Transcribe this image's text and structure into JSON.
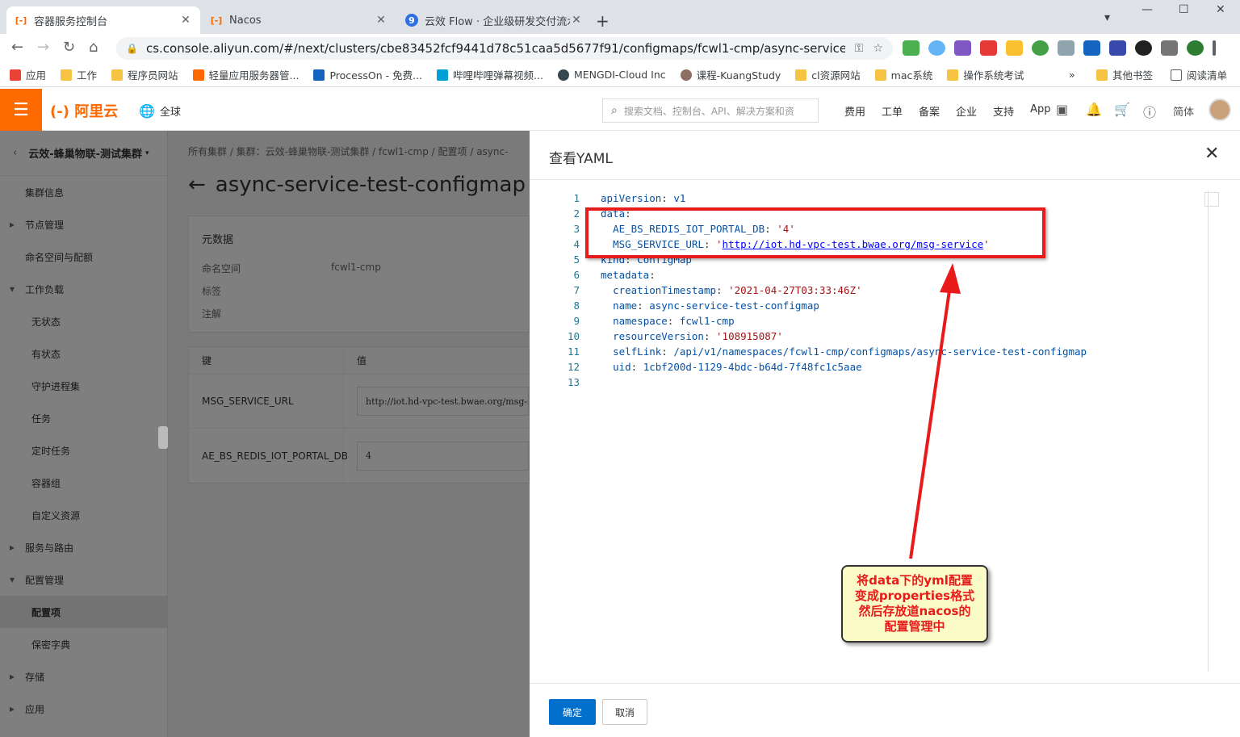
{
  "browser": {
    "tabs": [
      {
        "title": "容器服务控制台",
        "active": true
      },
      {
        "title": "Nacos",
        "active": false
      },
      {
        "title": "云效 Flow · 企业级研发交付流水线",
        "active": false
      }
    ],
    "url": "cs.console.aliyun.com/#/next/clusters/cbe83452fcf9441d78c51caa5d5677f91/configmaps/fcwl1-cmp/async-service-test-config...",
    "bookmarks": [
      "应用",
      "工作",
      "程序员网站",
      "轻量应用服务器管...",
      "ProcessOn - 免费...",
      "哔哩哔哩弹幕视频...",
      "MENGDI-Cloud Inc",
      "课程-KuangStudy",
      "cl资源网站",
      "mac系统",
      "操作系统考试"
    ],
    "bookmarks_right": [
      "其他书签",
      "阅读清单"
    ]
  },
  "header": {
    "logo": "阿里云",
    "region": "全球",
    "search_placeholder": "搜索文档、控制台、API、解决方案和资",
    "nav": [
      "费用",
      "工单",
      "备案",
      "企业",
      "支持",
      "App"
    ],
    "lang": "简体"
  },
  "sidebar": {
    "cluster": "云效-蜂巢物联-测试集群",
    "items": [
      {
        "label": "集群信息",
        "kind": "item"
      },
      {
        "label": "节点管理",
        "kind": "group"
      },
      {
        "label": "命名空间与配额",
        "kind": "item"
      },
      {
        "label": "工作负载",
        "kind": "group-open"
      },
      {
        "label": "无状态",
        "kind": "sub"
      },
      {
        "label": "有状态",
        "kind": "sub"
      },
      {
        "label": "守护进程集",
        "kind": "sub"
      },
      {
        "label": "任务",
        "kind": "sub"
      },
      {
        "label": "定时任务",
        "kind": "sub"
      },
      {
        "label": "容器组",
        "kind": "sub"
      },
      {
        "label": "自定义资源",
        "kind": "sub"
      },
      {
        "label": "服务与路由",
        "kind": "group"
      },
      {
        "label": "配置管理",
        "kind": "group-open"
      },
      {
        "label": "配置项",
        "kind": "sub-active"
      },
      {
        "label": "保密字典",
        "kind": "sub"
      },
      {
        "label": "存储",
        "kind": "group"
      },
      {
        "label": "应用",
        "kind": "group"
      }
    ]
  },
  "main": {
    "breadcrumb": "所有集群 / 集群：云效-蜂巢物联-测试集群 / fcwl1-cmp / 配置项 / async-",
    "title": "async-service-test-configmap",
    "metadata_title": "元数据",
    "namespace_label": "命名空间",
    "namespace_value": "fcwl1-cmp",
    "labels_label": "标签",
    "annotations_label": "注解",
    "col_key": "键",
    "col_value": "值",
    "rows": [
      {
        "key": "MSG_SERVICE_URL",
        "value": "http://iot.hd-vpc-test.bwae.org/msg-service"
      },
      {
        "key": "AE_BS_REDIS_IOT_PORTAL_DB",
        "value": "4"
      }
    ]
  },
  "drawer": {
    "title": "查看YAML",
    "ok": "确定",
    "cancel": "取消",
    "lines": [
      {
        "n": "1",
        "indent": "",
        "key": "apiVersion",
        "val": "v1",
        "type": "plain"
      },
      {
        "n": "2",
        "indent": "",
        "key": "data",
        "val": "",
        "type": "plain"
      },
      {
        "n": "3",
        "indent": "  ",
        "key": "AE_BS_REDIS_IOT_PORTAL_DB",
        "val": "'4'",
        "type": "str"
      },
      {
        "n": "4",
        "indent": "  ",
        "key": "MSG_SERVICE_URL",
        "val": "http://iot.hd-vpc-test.bwae.org/msg-service",
        "type": "url"
      },
      {
        "n": "5",
        "indent": "",
        "key": "kind",
        "val": "ConfigMap",
        "type": "plain"
      },
      {
        "n": "6",
        "indent": "",
        "key": "metadata",
        "val": "",
        "type": "plain"
      },
      {
        "n": "7",
        "indent": "  ",
        "key": "creationTimestamp",
        "val": "'2021-04-27T03:33:46Z'",
        "type": "str"
      },
      {
        "n": "8",
        "indent": "  ",
        "key": "name",
        "val": "async-service-test-configmap",
        "type": "plain"
      },
      {
        "n": "9",
        "indent": "  ",
        "key": "namespace",
        "val": "fcwl1-cmp",
        "type": "plain"
      },
      {
        "n": "10",
        "indent": "  ",
        "key": "resourceVersion",
        "val": "'108915087'",
        "type": "str"
      },
      {
        "n": "11",
        "indent": "  ",
        "key": "selfLink",
        "val": "/api/v1/namespaces/fcwl1-cmp/configmaps/async-service-test-configmap",
        "type": "plain"
      },
      {
        "n": "12",
        "indent": "  ",
        "key": "uid",
        "val": "1cbf200d-1129-4bdc-b64d-7f48fc1c5aae",
        "type": "plain"
      },
      {
        "n": "13",
        "indent": "",
        "key": "",
        "val": "",
        "type": "empty"
      }
    ]
  },
  "annotation": {
    "lines": [
      "将data下的yml配置",
      "变成properties格式",
      "然后存放道nacos的",
      "配置管理中"
    ],
    "color": "#e81a1a"
  }
}
